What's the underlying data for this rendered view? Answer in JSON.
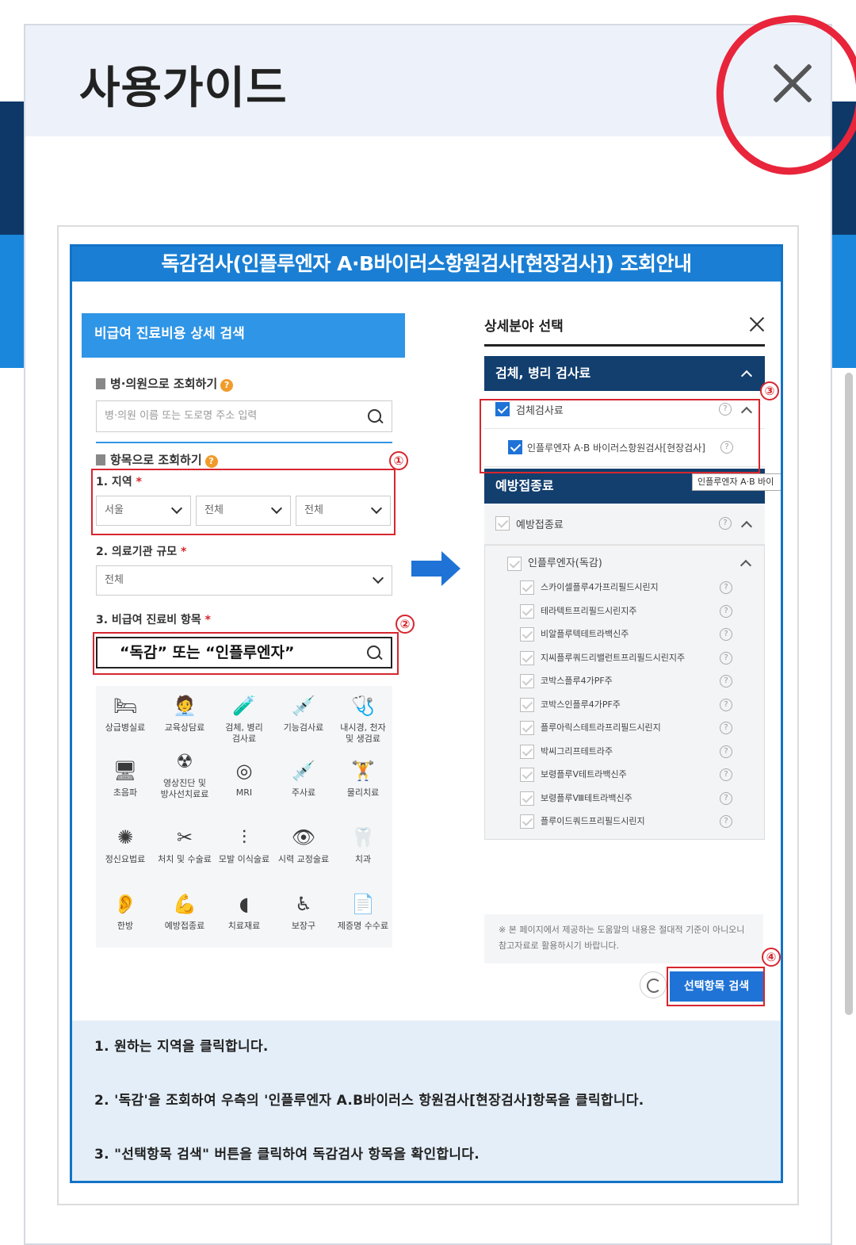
{
  "modal": {
    "title": "사용가이드"
  },
  "guide": {
    "title": "독감검사(인플루엔자 A·B바이러스항원검사[현장검사]) 조회안내",
    "left_panel": {
      "header": "비급여 진료비용 상세 검색",
      "hospital_search_label": "병·의원으로 조회하기",
      "hospital_search_placeholder": "병·의원 이름 또는 도로명 주소 입력",
      "item_search_label": "항목으로 조회하기",
      "region_label": "1. 지역",
      "region_selects": [
        "서울",
        "전체",
        "전체"
      ],
      "scale_label": "2. 의료기관 규모",
      "scale_select": "전체",
      "item_label": "3. 비급여 진료비 항목",
      "item_search_value": "“독감”  또는  “인플루엔자”",
      "required_mark": "*",
      "help_mark": "?",
      "categories": [
        [
          "상급병실료"
        ],
        [
          "교육상담료"
        ],
        [
          "검체, 병리",
          "검사료"
        ],
        [
          "기능검사료"
        ],
        [
          "내시경, 천자",
          "및 생검료"
        ],
        [
          "초음파"
        ],
        [
          "영상진단 및",
          "방사선치료료"
        ],
        [
          "MRI"
        ],
        [
          "주사료"
        ],
        [
          "물리치료"
        ],
        [
          "정신요법료"
        ],
        [
          "처치 및 수술료"
        ],
        [
          "모발 이식술료"
        ],
        [
          "시력 교정술료"
        ],
        [
          "치과"
        ],
        [
          "한방"
        ],
        [
          "예방접종료"
        ],
        [
          "치료재료"
        ],
        [
          "보장구"
        ],
        [
          "제증명 수수료"
        ]
      ]
    },
    "right_panel": {
      "header": "상세분야 선택",
      "cat1": "검체, 병리 검사료",
      "cat1_item": "검체검사료",
      "cat1_sub": "인플루엔자 A·B 바이러스항원검사[현장검사]",
      "tooltip": "인플루엔자 A·B 바이",
      "cat2": "예방접종료",
      "cat2_item": "예방접종료",
      "cat2_group": "인플루엔자(독감)",
      "vaccines": [
        "스카이셀플루4가프리필드시린지",
        "테라텍트프리필드시린지주",
        "비알플루텍테트라백신주",
        "지씨플루쿼드리밸런트프리필드시린지주",
        "코박스플루4가PF주",
        "코박스인플루4가PF주",
        "플루아릭스테트라프리필드시린지",
        "박씨그리프테트라주",
        "보령플루Ⅴ테트라백신주",
        "보령플루Ⅷ테트라백신주",
        "플루이드쿼드프리필드시린지"
      ],
      "notice": "※ 본 페이지에서 제공하는 도움말의 내용은 절대적 기준이 아니오니참고자료로 활용하시기 바랍니다.",
      "search_button": "선택항목 검색"
    },
    "markers": [
      "①",
      "②",
      "③",
      "④"
    ],
    "instructions": [
      "1. 원하는 지역을 클릭합니다.",
      "2. '독감'을 조회하여 우측의 '인플루엔자 A.B바이러스 항원검사[현장검사]항목을 클릭합니다.",
      "3. \"선택항목 검색\" 버튼을 클릭하여 독감검사 항목을 확인합니다."
    ]
  }
}
